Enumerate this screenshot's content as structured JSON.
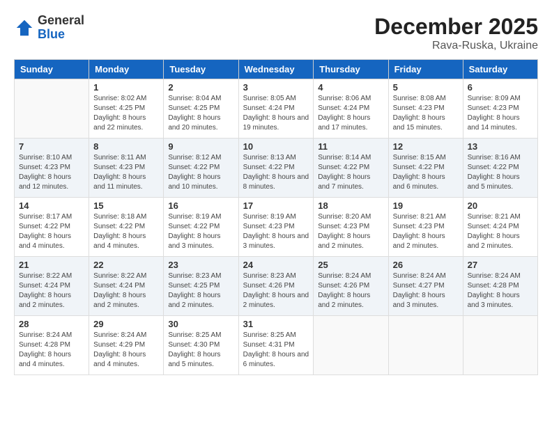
{
  "logo": {
    "general": "General",
    "blue": "Blue"
  },
  "title": "December 2025",
  "subtitle": "Rava-Ruska, Ukraine",
  "weekdays": [
    "Sunday",
    "Monday",
    "Tuesday",
    "Wednesday",
    "Thursday",
    "Friday",
    "Saturday"
  ],
  "weeks": [
    [
      {
        "day": "",
        "sunrise": "",
        "sunset": "",
        "daylight": ""
      },
      {
        "day": "1",
        "sunrise": "8:02 AM",
        "sunset": "4:25 PM",
        "daylight": "8 hours and 22 minutes."
      },
      {
        "day": "2",
        "sunrise": "8:04 AM",
        "sunset": "4:25 PM",
        "daylight": "8 hours and 20 minutes."
      },
      {
        "day": "3",
        "sunrise": "8:05 AM",
        "sunset": "4:24 PM",
        "daylight": "8 hours and 19 minutes."
      },
      {
        "day": "4",
        "sunrise": "8:06 AM",
        "sunset": "4:24 PM",
        "daylight": "8 hours and 17 minutes."
      },
      {
        "day": "5",
        "sunrise": "8:08 AM",
        "sunset": "4:23 PM",
        "daylight": "8 hours and 15 minutes."
      },
      {
        "day": "6",
        "sunrise": "8:09 AM",
        "sunset": "4:23 PM",
        "daylight": "8 hours and 14 minutes."
      }
    ],
    [
      {
        "day": "7",
        "sunrise": "8:10 AM",
        "sunset": "4:23 PM",
        "daylight": "8 hours and 12 minutes."
      },
      {
        "day": "8",
        "sunrise": "8:11 AM",
        "sunset": "4:23 PM",
        "daylight": "8 hours and 11 minutes."
      },
      {
        "day": "9",
        "sunrise": "8:12 AM",
        "sunset": "4:22 PM",
        "daylight": "8 hours and 10 minutes."
      },
      {
        "day": "10",
        "sunrise": "8:13 AM",
        "sunset": "4:22 PM",
        "daylight": "8 hours and 8 minutes."
      },
      {
        "day": "11",
        "sunrise": "8:14 AM",
        "sunset": "4:22 PM",
        "daylight": "8 hours and 7 minutes."
      },
      {
        "day": "12",
        "sunrise": "8:15 AM",
        "sunset": "4:22 PM",
        "daylight": "8 hours and 6 minutes."
      },
      {
        "day": "13",
        "sunrise": "8:16 AM",
        "sunset": "4:22 PM",
        "daylight": "8 hours and 5 minutes."
      }
    ],
    [
      {
        "day": "14",
        "sunrise": "8:17 AM",
        "sunset": "4:22 PM",
        "daylight": "8 hours and 4 minutes."
      },
      {
        "day": "15",
        "sunrise": "8:18 AM",
        "sunset": "4:22 PM",
        "daylight": "8 hours and 4 minutes."
      },
      {
        "day": "16",
        "sunrise": "8:19 AM",
        "sunset": "4:22 PM",
        "daylight": "8 hours and 3 minutes."
      },
      {
        "day": "17",
        "sunrise": "8:19 AM",
        "sunset": "4:23 PM",
        "daylight": "8 hours and 3 minutes."
      },
      {
        "day": "18",
        "sunrise": "8:20 AM",
        "sunset": "4:23 PM",
        "daylight": "8 hours and 2 minutes."
      },
      {
        "day": "19",
        "sunrise": "8:21 AM",
        "sunset": "4:23 PM",
        "daylight": "8 hours and 2 minutes."
      },
      {
        "day": "20",
        "sunrise": "8:21 AM",
        "sunset": "4:24 PM",
        "daylight": "8 hours and 2 minutes."
      }
    ],
    [
      {
        "day": "21",
        "sunrise": "8:22 AM",
        "sunset": "4:24 PM",
        "daylight": "8 hours and 2 minutes."
      },
      {
        "day": "22",
        "sunrise": "8:22 AM",
        "sunset": "4:24 PM",
        "daylight": "8 hours and 2 minutes."
      },
      {
        "day": "23",
        "sunrise": "8:23 AM",
        "sunset": "4:25 PM",
        "daylight": "8 hours and 2 minutes."
      },
      {
        "day": "24",
        "sunrise": "8:23 AM",
        "sunset": "4:26 PM",
        "daylight": "8 hours and 2 minutes."
      },
      {
        "day": "25",
        "sunrise": "8:24 AM",
        "sunset": "4:26 PM",
        "daylight": "8 hours and 2 minutes."
      },
      {
        "day": "26",
        "sunrise": "8:24 AM",
        "sunset": "4:27 PM",
        "daylight": "8 hours and 3 minutes."
      },
      {
        "day": "27",
        "sunrise": "8:24 AM",
        "sunset": "4:28 PM",
        "daylight": "8 hours and 3 minutes."
      }
    ],
    [
      {
        "day": "28",
        "sunrise": "8:24 AM",
        "sunset": "4:28 PM",
        "daylight": "8 hours and 4 minutes."
      },
      {
        "day": "29",
        "sunrise": "8:24 AM",
        "sunset": "4:29 PM",
        "daylight": "8 hours and 4 minutes."
      },
      {
        "day": "30",
        "sunrise": "8:25 AM",
        "sunset": "4:30 PM",
        "daylight": "8 hours and 5 minutes."
      },
      {
        "day": "31",
        "sunrise": "8:25 AM",
        "sunset": "4:31 PM",
        "daylight": "8 hours and 6 minutes."
      },
      {
        "day": "",
        "sunrise": "",
        "sunset": "",
        "daylight": ""
      },
      {
        "day": "",
        "sunrise": "",
        "sunset": "",
        "daylight": ""
      },
      {
        "day": "",
        "sunrise": "",
        "sunset": "",
        "daylight": ""
      }
    ]
  ],
  "labels": {
    "sunrise": "Sunrise:",
    "sunset": "Sunset:",
    "daylight": "Daylight:"
  }
}
